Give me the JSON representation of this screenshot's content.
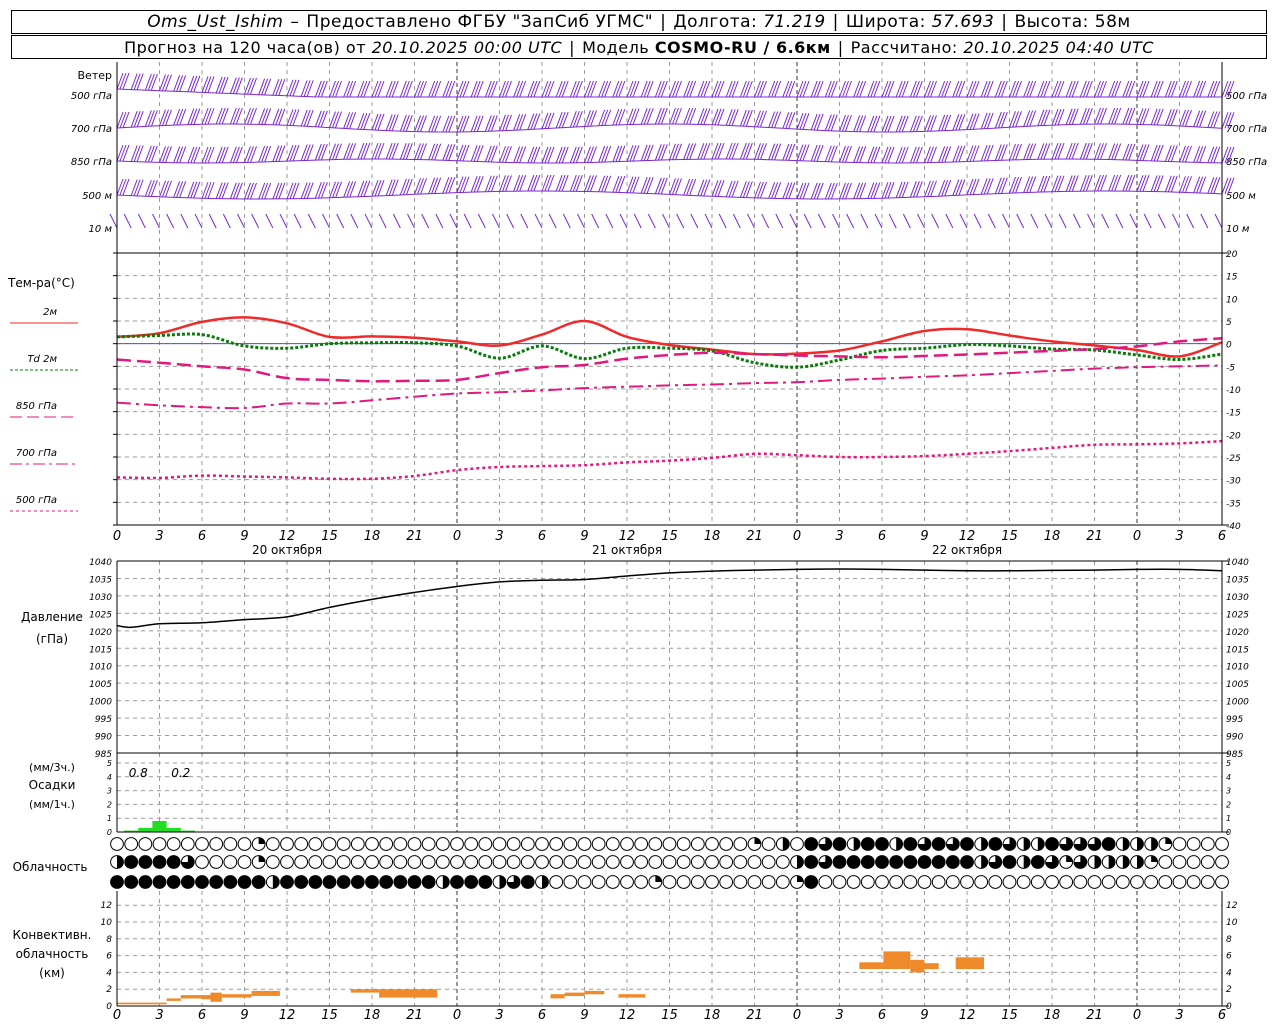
{
  "header": {
    "line1": {
      "station": "Oms_Ust_Ishim",
      "dash": "–",
      "provider": "Предоставлено ФГБУ \"ЗапСиб УГМС\"",
      "lon_label": "Долгота:",
      "lon_value": "71.219",
      "lat_label": "Широта:",
      "lat_value": "57.693",
      "alt_label": "Высота:",
      "alt_value": "58м"
    },
    "line2": {
      "forecast_prefix": "Прогноз на 120 часа(ов) от",
      "forecast_start": "20.10.2025 00:00 UTC",
      "model_label": "Модель",
      "model_name": "COSMO-RU / 6.6км",
      "calc_label": "Рассчитано:",
      "calc_time": "20.10.2025 04:40 UTC"
    }
  },
  "colors": {
    "wind": "#7b28d0",
    "t2m": "#ee2a2a",
    "td2m": "#0a7a0a",
    "t850": "#e0197d",
    "t700": "#e0197d",
    "t500": "#e0197d",
    "pressure": "#000000",
    "precip": "#22dd22",
    "convective": "#ee8a2a",
    "grid": "#9a9a9a",
    "zero_line": "#3b5bd6"
  },
  "x_hour_ticks": [
    "0",
    "3",
    "6",
    "9",
    "12",
    "15",
    "18",
    "21",
    "0",
    "3",
    "6",
    "9",
    "12",
    "15",
    "18",
    "21",
    "0",
    "3",
    "6",
    "9",
    "12",
    "15",
    "18",
    "21",
    "0",
    "3",
    "6"
  ],
  "day_labels": [
    "20 октября",
    "21 октября",
    "22 октября"
  ],
  "wind": {
    "title": "Ветер",
    "levels": [
      "500 гПа",
      "700 гПа",
      "850 гПа",
      "500 м",
      "10  м"
    ]
  },
  "temperature": {
    "title": "Тем-ра(°С)",
    "legend": [
      {
        "label": "2м",
        "style": "solid"
      },
      {
        "label": "Td  2м",
        "style": "dotted"
      },
      {
        "label": "850 гПа",
        "style": "dash"
      },
      {
        "label": "700 гПа",
        "style": "dashdot"
      },
      {
        "label": "500 гПа",
        "style": "dotdash"
      }
    ],
    "y_ticks": [
      "20",
      "15",
      "10",
      "5",
      "0",
      "-5",
      "-10",
      "-15",
      "-20",
      "-25",
      "-30",
      "-35",
      "-40"
    ]
  },
  "pressure": {
    "title": "Давление",
    "unit": "(гПа)",
    "y_ticks": [
      "1040",
      "1035",
      "1030",
      "1025",
      "1020",
      "1015",
      "1010",
      "1005",
      "1000",
      "995",
      "990",
      "985"
    ]
  },
  "precip": {
    "unit3h": "(мм/3ч.)",
    "title": "Осадки",
    "unit1h": "(мм/1ч.)",
    "y_ticks": [
      "5",
      "4",
      "3",
      "2",
      "1",
      "0"
    ],
    "totals": [
      "0.8",
      "0.2"
    ]
  },
  "clouds": {
    "title": "Облачность"
  },
  "convective": {
    "title_l1": "Конвективн.",
    "title_l2": "облачность",
    "unit": "(км)",
    "y_ticks": [
      "12",
      "10",
      "8",
      "6",
      "4",
      "2",
      "0"
    ]
  },
  "chart_data": [
    {
      "type": "line",
      "title": "Тем-ра(°С)",
      "x_unit": "hours since 20.10.2025 00:00 UTC",
      "ylim": [
        -40,
        20
      ],
      "grid": true,
      "series": [
        {
          "name": "2м",
          "x": [
            0,
            3,
            6,
            9,
            12,
            15,
            18,
            21,
            24,
            27,
            30,
            33,
            36,
            39,
            42,
            45,
            48,
            51,
            54,
            57,
            60,
            63,
            66,
            69,
            72,
            75,
            78
          ],
          "values": [
            1.5,
            2.3,
            4.8,
            5.8,
            4.5,
            1.5,
            1.6,
            1.3,
            0.5,
            -0.4,
            2.0,
            5.0,
            1.5,
            -0.3,
            -1.3,
            -2.3,
            -2.2,
            -1.5,
            0.5,
            2.8,
            3.2,
            1.8,
            0.5,
            -0.4,
            -1.4,
            -2.8,
            0.3
          ]
        },
        {
          "name": "Td  2м",
          "x": [
            0,
            3,
            6,
            9,
            12,
            15,
            18,
            21,
            24,
            27,
            30,
            33,
            36,
            39,
            42,
            45,
            48,
            51,
            54,
            57,
            60,
            63,
            66,
            69,
            72,
            75,
            78
          ],
          "values": [
            1.5,
            1.8,
            2.0,
            -0.5,
            -1.0,
            0.0,
            0.2,
            0.2,
            -0.5,
            -3.2,
            -0.5,
            -3.3,
            -1.0,
            -1.0,
            -1.6,
            -4.2,
            -5.2,
            -3.6,
            -1.5,
            -1.0,
            -0.2,
            -0.5,
            -1.2,
            -1.4,
            -2.5,
            -3.5,
            -2.3
          ]
        },
        {
          "name": "850 гПа",
          "x": [
            0,
            3,
            6,
            9,
            12,
            15,
            18,
            21,
            24,
            27,
            30,
            33,
            36,
            39,
            42,
            45,
            48,
            51,
            54,
            57,
            60,
            63,
            66,
            69,
            72,
            75,
            78
          ],
          "values": [
            -3.5,
            -4.2,
            -5.0,
            -5.7,
            -7.6,
            -8.0,
            -8.3,
            -8.2,
            -8.0,
            -6.5,
            -5.2,
            -4.7,
            -3.3,
            -2.5,
            -2.0,
            -2.3,
            -2.6,
            -2.8,
            -3.0,
            -2.7,
            -2.4,
            -2.0,
            -1.6,
            -1.2,
            -0.6,
            0.5,
            1.2
          ]
        },
        {
          "name": "700 гПа",
          "x": [
            0,
            3,
            6,
            9,
            12,
            15,
            18,
            21,
            24,
            27,
            30,
            33,
            36,
            39,
            42,
            45,
            48,
            51,
            54,
            57,
            60,
            63,
            66,
            69,
            72,
            75,
            78
          ],
          "values": [
            -13.0,
            -13.6,
            -14.0,
            -14.2,
            -13.2,
            -13.2,
            -12.5,
            -11.7,
            -11.0,
            -10.7,
            -10.3,
            -9.8,
            -9.5,
            -9.2,
            -9.0,
            -8.7,
            -8.5,
            -8.0,
            -7.7,
            -7.3,
            -7.0,
            -6.5,
            -6.0,
            -5.5,
            -5.2,
            -5.0,
            -4.8
          ]
        },
        {
          "name": "500 гПа",
          "x": [
            0,
            3,
            6,
            9,
            12,
            15,
            18,
            21,
            24,
            27,
            30,
            33,
            36,
            39,
            42,
            45,
            48,
            51,
            54,
            57,
            60,
            63,
            66,
            69,
            72,
            75,
            78
          ],
          "values": [
            -29.5,
            -29.6,
            -29.1,
            -29.3,
            -29.5,
            -29.8,
            -29.8,
            -29.2,
            -27.9,
            -27.2,
            -27.0,
            -26.8,
            -26.2,
            -25.8,
            -25.2,
            -24.3,
            -24.6,
            -25.0,
            -25.0,
            -24.8,
            -24.3,
            -23.7,
            -23.0,
            -22.3,
            -22.2,
            -22.0,
            -21.5
          ]
        }
      ]
    },
    {
      "type": "line",
      "title": "Давление",
      "x_unit": "hours since 20.10.2025 00:00 UTC",
      "ylim": [
        985,
        1040
      ],
      "grid": true,
      "series": [
        {
          "name": "Давление",
          "x": [
            0,
            1,
            3,
            6,
            9,
            12,
            15,
            18,
            21,
            24,
            27,
            30,
            33,
            36,
            39,
            42,
            45,
            48,
            51,
            54,
            57,
            60,
            63,
            66,
            69,
            72,
            75,
            78
          ],
          "values": [
            1021.5,
            1021.0,
            1022.0,
            1022.3,
            1023.2,
            1024.0,
            1026.7,
            1029.0,
            1031.0,
            1032.7,
            1034.0,
            1034.5,
            1034.7,
            1035.7,
            1036.6,
            1037.1,
            1037.4,
            1037.6,
            1037.7,
            1037.6,
            1037.4,
            1037.2,
            1037.2,
            1037.3,
            1037.4,
            1037.6,
            1037.6,
            1037.2
          ]
        }
      ]
    },
    {
      "type": "bar",
      "title": "Осадки",
      "x_unit": "hours since 20.10.2025 00:00 UTC",
      "ylim": [
        0,
        5
      ],
      "series": [
        {
          "name": "мм/1ч.",
          "x": [
            1,
            2,
            3,
            4,
            5,
            18
          ],
          "values": [
            0.1,
            0.3,
            0.8,
            0.3,
            0.1,
            0.05
          ]
        }
      ]
    },
    {
      "type": "bar",
      "title": "Облачность",
      "rows": 3,
      "x_unit": "hours since 20.10.2025 00:00 UTC",
      "x": [
        0,
        1,
        2,
        3,
        4,
        5,
        6,
        7,
        8,
        9,
        10,
        11,
        12,
        13,
        14,
        15,
        16,
        17,
        18,
        19,
        20,
        21,
        22,
        23,
        24,
        25,
        26,
        27,
        28,
        29,
        30,
        31,
        32,
        33,
        34,
        35,
        36,
        37,
        38,
        39,
        40,
        41,
        42,
        43,
        44,
        45,
        46,
        47,
        48,
        49,
        50,
        51,
        52,
        53,
        54,
        55,
        56,
        57,
        58,
        59,
        60,
        61,
        62,
        63,
        64,
        65,
        66,
        67,
        68,
        69,
        70,
        71,
        72,
        73,
        74,
        75,
        76,
        77,
        78
      ],
      "cover_upper": [
        0,
        0,
        0,
        0,
        0,
        0,
        0,
        0,
        0,
        0,
        0.25,
        0,
        0,
        0,
        0,
        0,
        0,
        0,
        0,
        0,
        0,
        0,
        0,
        0,
        0,
        0,
        0,
        0,
        0,
        0,
        0,
        0,
        0,
        0,
        0,
        0,
        0,
        0,
        0,
        0,
        0,
        0,
        0,
        0,
        0,
        0.25,
        0,
        0.5,
        0,
        1,
        0.75,
        1,
        0.5,
        1,
        1,
        0.5,
        1,
        0.75,
        1,
        0.75,
        1,
        0.5,
        1,
        0.75,
        0.5,
        0.5,
        1,
        0.75,
        0.75,
        0.75,
        1,
        0.5,
        0.5,
        0.5,
        0.25,
        0,
        0,
        0,
        0
      ],
      "cover_middle": [
        0.5,
        1,
        1,
        1,
        1,
        0.75,
        0,
        0,
        0,
        0,
        0.25,
        0,
        0,
        0,
        0,
        0,
        0,
        0,
        0,
        0,
        0,
        0,
        0,
        0,
        0,
        0,
        0,
        0,
        0,
        0,
        0,
        0,
        0,
        0,
        0,
        0,
        0,
        0,
        0,
        0,
        0,
        0,
        0,
        0,
        0,
        0,
        0,
        0,
        0.5,
        1,
        0.75,
        1,
        1,
        1,
        1,
        1,
        1,
        1,
        1,
        1,
        1,
        0.5,
        0.75,
        1,
        0.5,
        1,
        0.75,
        0.25,
        0.75,
        0.5,
        0.5,
        0.5,
        0.5,
        0.25,
        0,
        0,
        0,
        0,
        0
      ],
      "cover_lower": [
        1,
        1,
        1,
        1,
        1,
        1,
        1,
        1,
        1,
        1,
        1,
        0.5,
        1,
        1,
        1,
        1,
        1,
        1,
        1,
        1,
        1,
        1,
        1,
        0.5,
        1,
        1,
        1,
        0.5,
        0.75,
        1,
        0.5,
        0,
        0,
        0,
        0,
        0,
        0,
        0,
        0.25,
        0,
        0,
        0,
        0,
        0,
        0,
        0,
        0,
        0,
        0.25,
        1,
        0,
        0,
        0,
        0,
        0,
        0,
        0,
        0,
        0,
        0,
        0,
        0,
        0,
        0,
        0,
        0,
        0,
        0,
        0,
        0,
        0,
        0,
        0,
        0,
        0,
        0,
        0,
        0,
        0
      ]
    },
    {
      "type": "bar",
      "title": "Конвективн. облачность",
      "x_unit": "hours since 20.10.2025 00:00 UTC",
      "ylim": [
        0,
        13
      ],
      "segments": [
        {
          "x0": 0,
          "x1": 3.5,
          "base": 0.2,
          "top": 0.4
        },
        {
          "x0": 3.5,
          "x1": 4.5,
          "base": 0.6,
          "top": 0.9
        },
        {
          "x0": 4.5,
          "x1": 6,
          "base": 0.9,
          "top": 1.3
        },
        {
          "x0": 6,
          "x1": 6.6,
          "base": 0.8,
          "top": 1.3
        },
        {
          "x0": 6.6,
          "x1": 7.4,
          "base": 0.5,
          "top": 1.6
        },
        {
          "x0": 7.4,
          "x1": 9.5,
          "base": 1.0,
          "top": 1.4
        },
        {
          "x0": 9.5,
          "x1": 11.5,
          "base": 1.2,
          "top": 1.8
        },
        {
          "x0": 16.5,
          "x1": 18.5,
          "base": 1.6,
          "top": 2.0
        },
        {
          "x0": 18.5,
          "x1": 22.6,
          "base": 1.0,
          "top": 2.0
        },
        {
          "x0": 30.6,
          "x1": 31.6,
          "base": 0.9,
          "top": 1.4
        },
        {
          "x0": 31.6,
          "x1": 33,
          "base": 1.2,
          "top": 1.6
        },
        {
          "x0": 33,
          "x1": 34.4,
          "base": 1.4,
          "top": 1.8
        },
        {
          "x0": 35.4,
          "x1": 37.3,
          "base": 1.0,
          "top": 1.4
        },
        {
          "x0": 52.4,
          "x1": 54.1,
          "base": 4.4,
          "top": 5.2
        },
        {
          "x0": 54.1,
          "x1": 56,
          "base": 4.4,
          "top": 6.5
        },
        {
          "x0": 56,
          "x1": 57,
          "base": 4.0,
          "top": 5.5
        },
        {
          "x0": 57,
          "x1": 58,
          "base": 4.4,
          "top": 5.1
        },
        {
          "x0": 59.2,
          "x1": 61.2,
          "base": 4.4,
          "top": 5.8
        }
      ]
    }
  ]
}
